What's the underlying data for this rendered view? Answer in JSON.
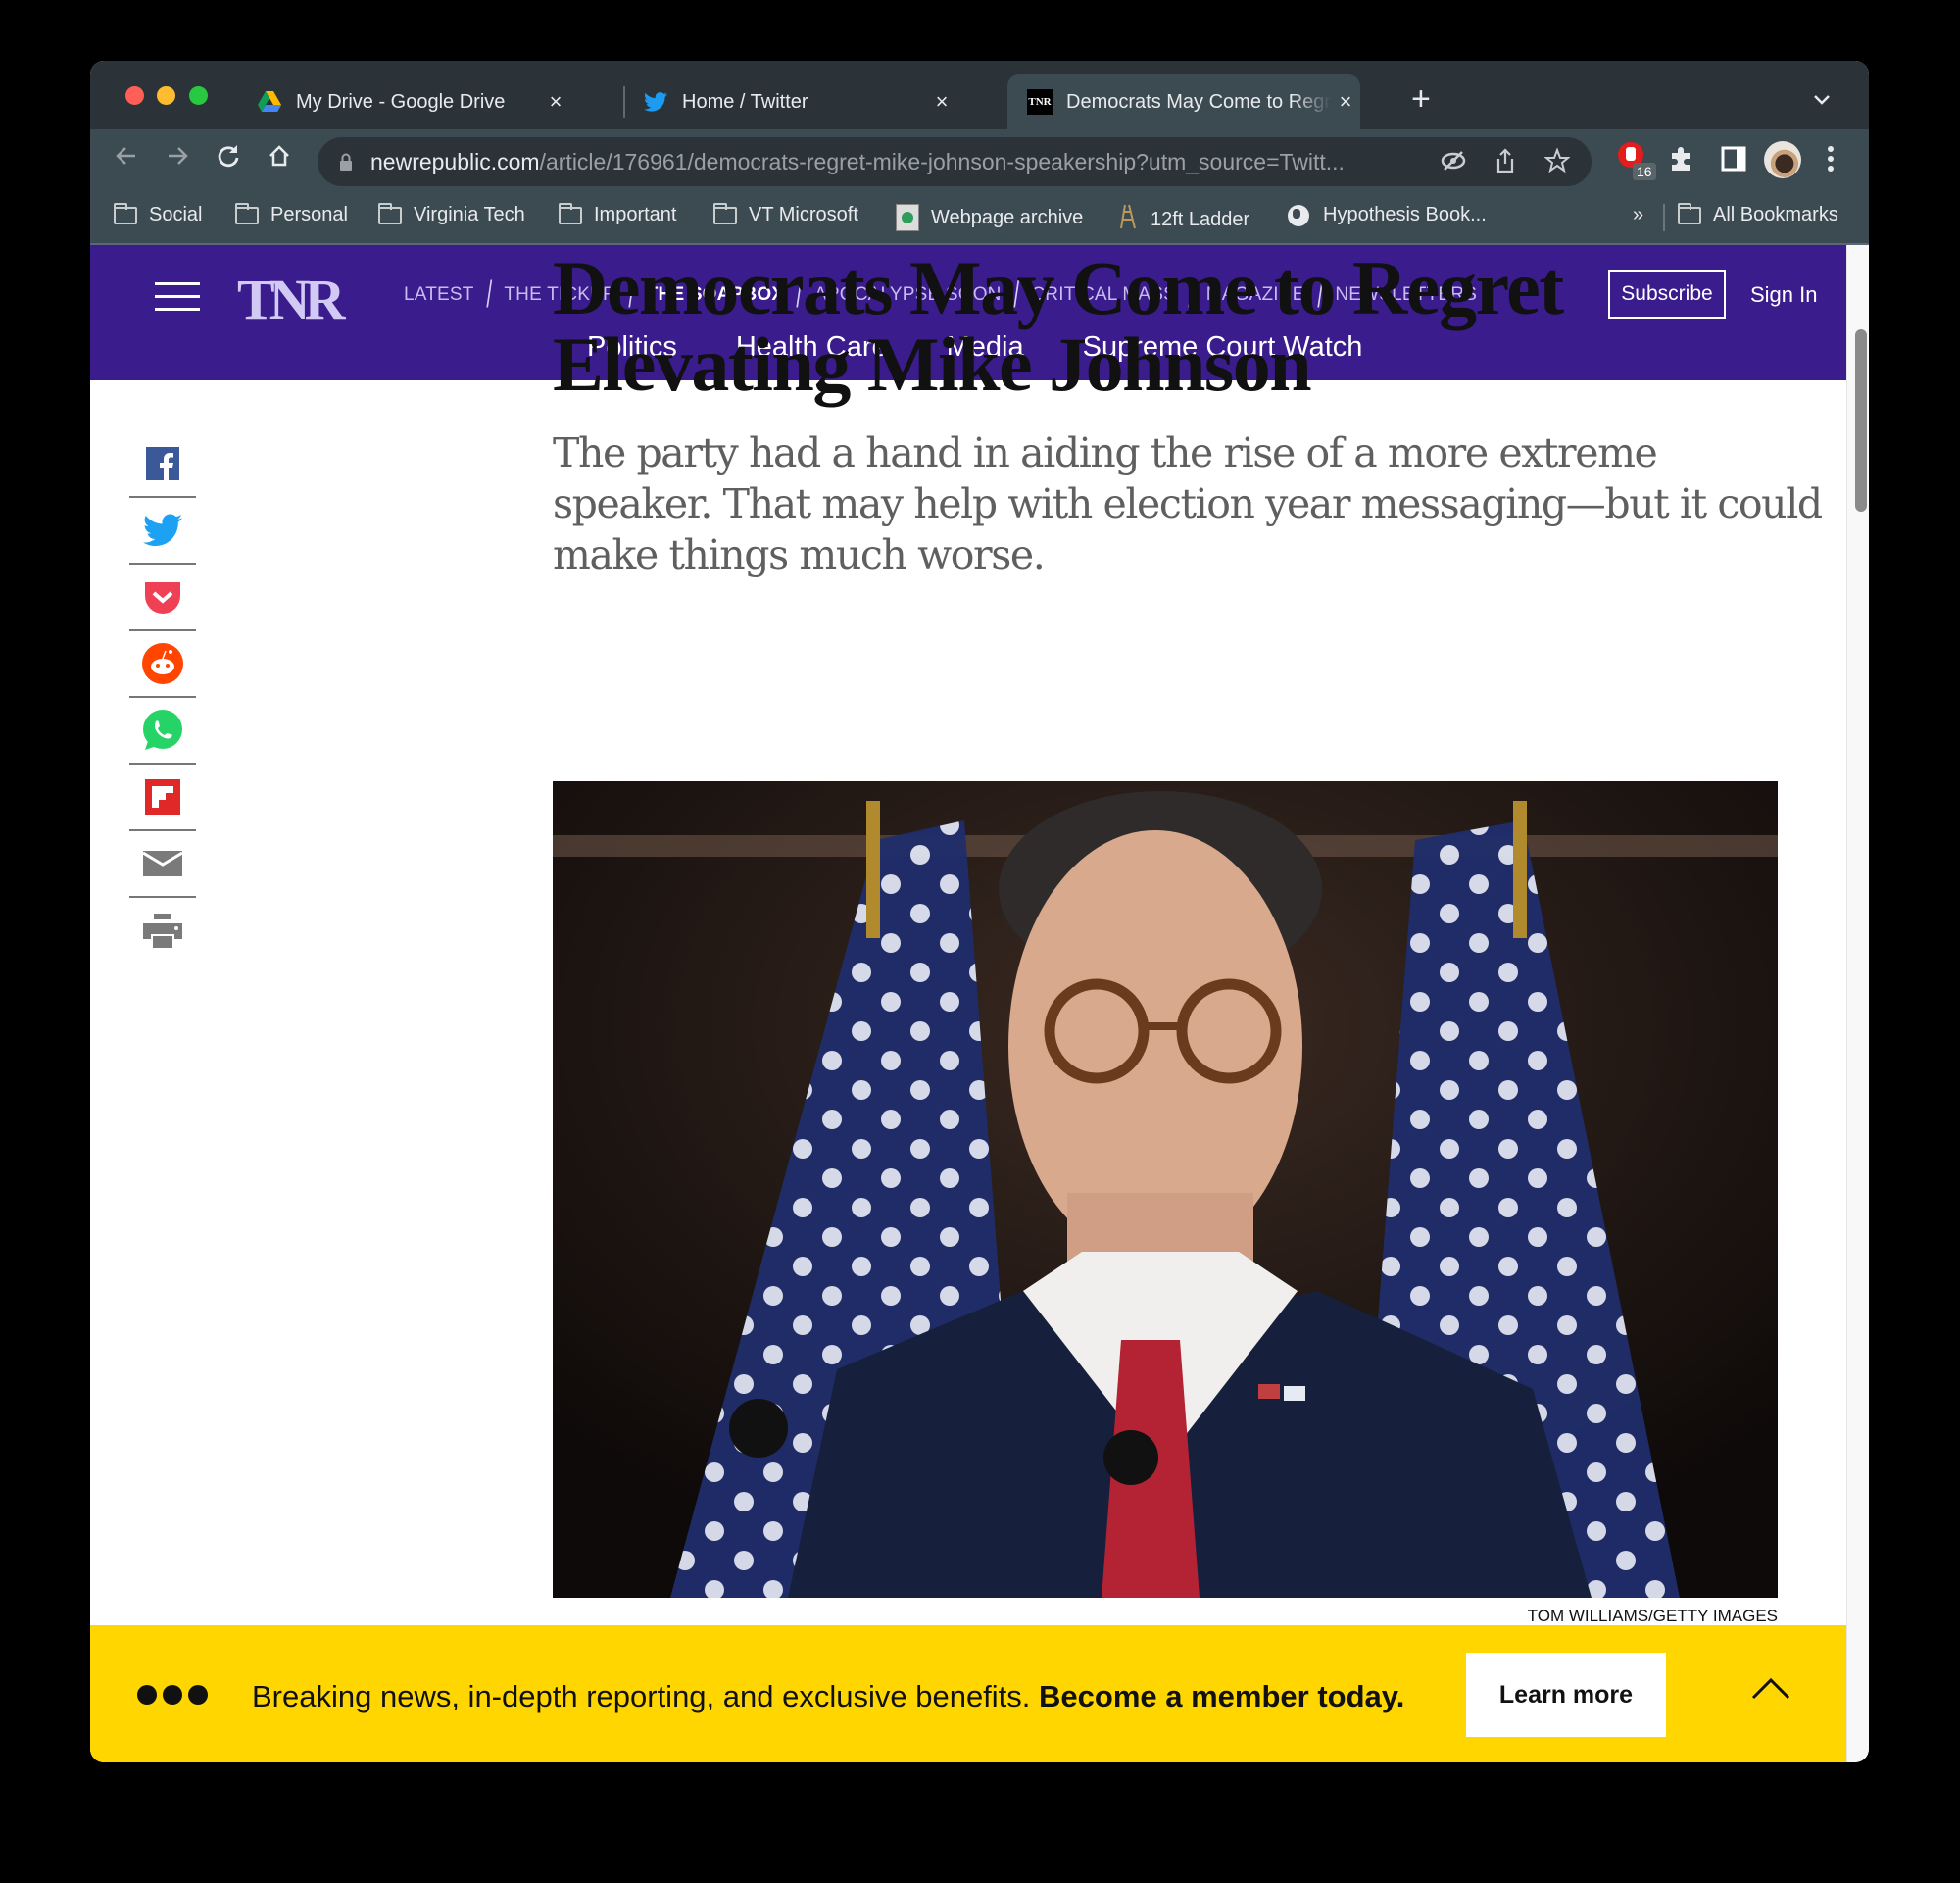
{
  "browser": {
    "tabs": [
      {
        "title": "My Drive - Google Drive",
        "icon": "google-drive-icon",
        "active": false
      },
      {
        "title": "Home / Twitter",
        "icon": "twitter-icon",
        "active": false
      },
      {
        "title": "Democrats May Come to Regret",
        "icon": "tnr-favicon",
        "active": true
      }
    ],
    "close_glyph": "×",
    "new_tab_glyph": "+",
    "tab_menu_glyph": "⌄",
    "url_host": "newrepublic.com",
    "url_path": "/article/176961/democrats-regret-mike-johnson-speakership?utm_source=Twitt...",
    "extension_badge": "16",
    "bookmarks": [
      {
        "label": "Social",
        "icon": "folder-icon"
      },
      {
        "label": "Personal",
        "icon": "folder-icon"
      },
      {
        "label": "Virginia Tech",
        "icon": "folder-icon"
      },
      {
        "label": "Important",
        "icon": "folder-icon"
      },
      {
        "label": "VT Microsoft",
        "icon": "folder-icon"
      },
      {
        "label": "Webpage archive",
        "icon": "archive-icon"
      },
      {
        "label": "12ft Ladder",
        "icon": "ladder-icon"
      },
      {
        "label": "Hypothesis Book...",
        "icon": "globe-icon"
      }
    ],
    "bookmarks_overflow": "»",
    "all_bookmarks": "All Bookmarks"
  },
  "site": {
    "logo": "TNR",
    "top_nav": [
      "LATEST",
      "THE TICKER",
      "THE SOAPBOX",
      "APOCALYPSE SOON",
      "CRITICAL MASS",
      "MAGAZINE",
      "NEWSLETTERS"
    ],
    "top_nav_active": "THE SOAPBOX",
    "sub_nav": [
      "Politics",
      "Health Care",
      "Media",
      "Supreme Court Watch"
    ],
    "subscribe": "Subscribe",
    "sign_in": "Sign In",
    "colors": {
      "header": "#3a1c8c",
      "banner": "#ffd600"
    }
  },
  "share": [
    "facebook",
    "twitter",
    "pocket",
    "reddit",
    "whatsapp",
    "flipboard",
    "email",
    "print"
  ],
  "article": {
    "headline": "Democrats May Come to Regret Elevating Mike Johnson",
    "dek": "The party had a hand in aiding the rise of a more extreme speaker. That may help with election year messaging—but it could make things much worse.",
    "photo_alt": "Mike Johnson in front of American flags",
    "photo_credit": "TOM WILLIAMS/GETTY IMAGES"
  },
  "banner": {
    "text": "Breaking news, in-depth reporting, and exclusive benefits.",
    "cta_bold": "Become a member today.",
    "button": "Learn more"
  }
}
